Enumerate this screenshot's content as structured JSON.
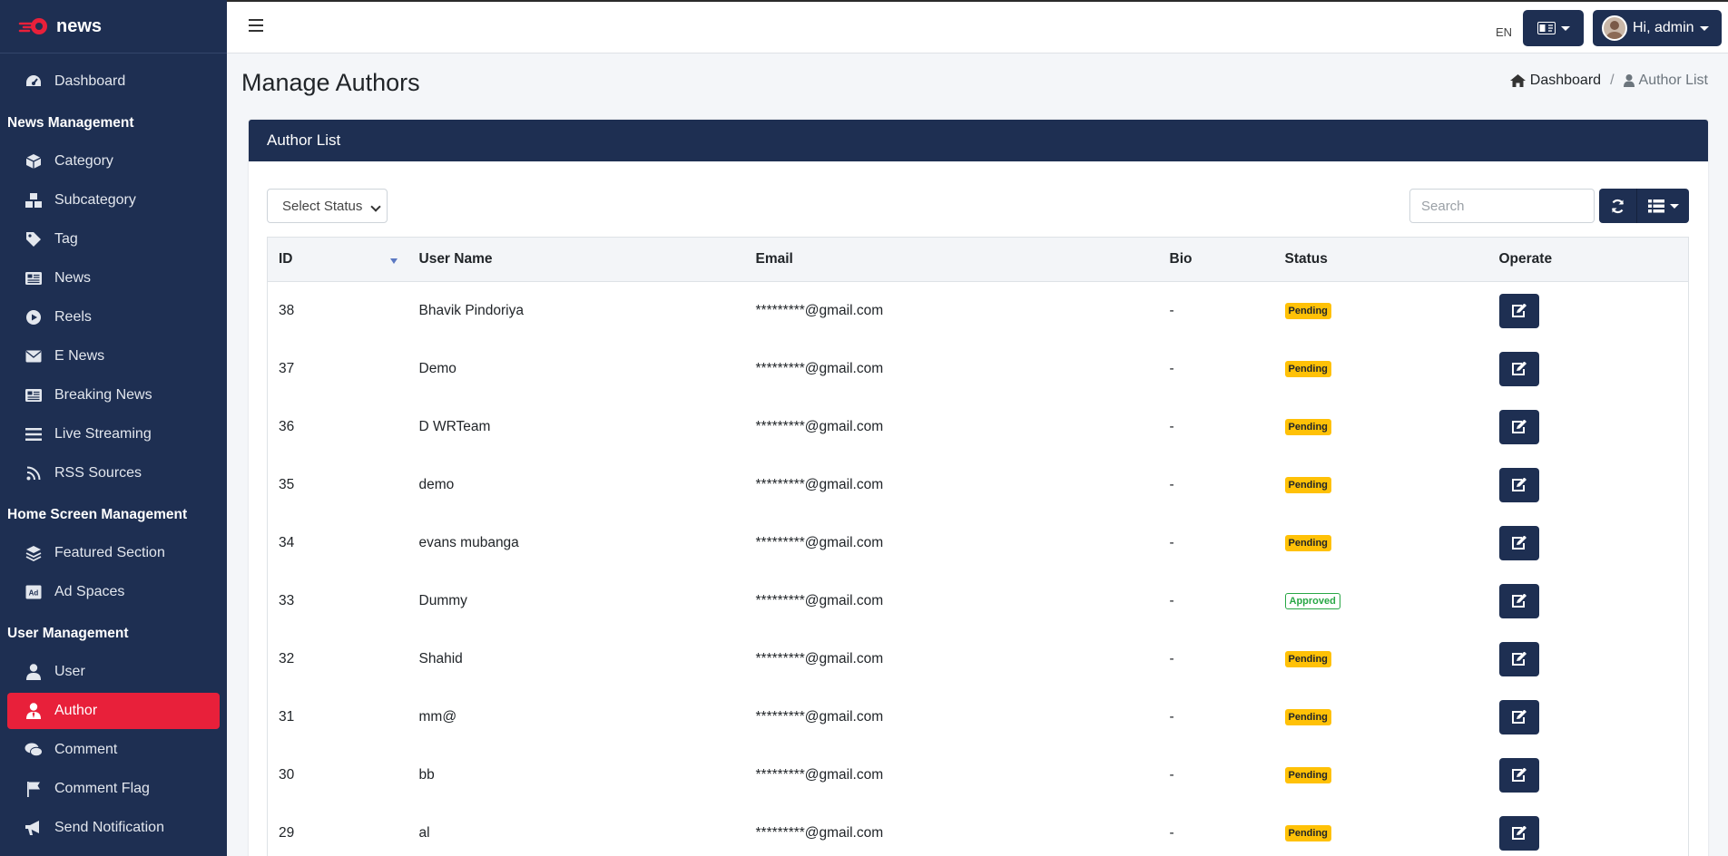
{
  "brand": {
    "name": "news"
  },
  "sidebar": {
    "items": [
      {
        "type": "item",
        "label": "Dashboard",
        "icon": "tachometer-icon",
        "name": "sidebar-item-dashboard"
      },
      {
        "type": "header",
        "label": "News Management"
      },
      {
        "type": "item",
        "label": "Category",
        "icon": "cube-icon",
        "name": "sidebar-item-category"
      },
      {
        "type": "item",
        "label": "Subcategory",
        "icon": "cubes-icon",
        "name": "sidebar-item-subcategory"
      },
      {
        "type": "item",
        "label": "Tag",
        "icon": "tag-icon",
        "name": "sidebar-item-tag"
      },
      {
        "type": "item",
        "label": "News",
        "icon": "newspaper-icon",
        "name": "sidebar-item-news"
      },
      {
        "type": "item",
        "label": "Reels",
        "icon": "play-circle-icon",
        "name": "sidebar-item-reels"
      },
      {
        "type": "item",
        "label": "E News",
        "icon": "envelope-icon",
        "name": "sidebar-item-e-news"
      },
      {
        "type": "item",
        "label": "Breaking News",
        "icon": "newspaper-icon",
        "name": "sidebar-item-breaking-news"
      },
      {
        "type": "item",
        "label": "Live Streaming",
        "icon": "bars-icon",
        "name": "sidebar-item-live-streaming"
      },
      {
        "type": "item",
        "label": "RSS Sources",
        "icon": "rss-icon",
        "name": "sidebar-item-rss-sources"
      },
      {
        "type": "header",
        "label": "Home Screen Management"
      },
      {
        "type": "item",
        "label": "Featured Section",
        "icon": "layers-icon",
        "name": "sidebar-item-featured-section"
      },
      {
        "type": "item",
        "label": "Ad Spaces",
        "icon": "ad-icon",
        "name": "sidebar-item-ad-spaces"
      },
      {
        "type": "header",
        "label": "User Management"
      },
      {
        "type": "item",
        "label": "User",
        "icon": "user-icon",
        "name": "sidebar-item-user"
      },
      {
        "type": "item",
        "label": "Author",
        "icon": "user-tie-icon",
        "name": "sidebar-item-author",
        "active": true
      },
      {
        "type": "item",
        "label": "Comment",
        "icon": "comments-icon",
        "name": "sidebar-item-comment"
      },
      {
        "type": "item",
        "label": "Comment Flag",
        "icon": "flag-icon",
        "name": "sidebar-item-comment-flag"
      },
      {
        "type": "item",
        "label": "Send Notification",
        "icon": "bullhorn-icon",
        "name": "sidebar-item-send-notification"
      }
    ]
  },
  "topbar": {
    "language_code": "EN",
    "user_greeting": "Hi, admin"
  },
  "page": {
    "title": "Manage Authors",
    "breadcrumb": {
      "home": "Dashboard",
      "current": "Author List"
    }
  },
  "card": {
    "title": "Author List",
    "status_select": "Select Status",
    "search_placeholder": "Search"
  },
  "table": {
    "columns": [
      "ID",
      "User Name",
      "Email",
      "Bio",
      "Status",
      "Operate"
    ],
    "rows": [
      {
        "id": "38",
        "name": "Bhavik Pindoriya",
        "email": "*********@gmail.com",
        "bio": "-",
        "status": "Pending"
      },
      {
        "id": "37",
        "name": "Demo",
        "email": "*********@gmail.com",
        "bio": "-",
        "status": "Pending"
      },
      {
        "id": "36",
        "name": "D WRTeam",
        "email": "*********@gmail.com",
        "bio": "-",
        "status": "Pending"
      },
      {
        "id": "35",
        "name": "demo",
        "email": "*********@gmail.com",
        "bio": "-",
        "status": "Pending"
      },
      {
        "id": "34",
        "name": "evans mubanga",
        "email": "*********@gmail.com",
        "bio": "-",
        "status": "Pending"
      },
      {
        "id": "33",
        "name": "Dummy",
        "email": "*********@gmail.com",
        "bio": "-",
        "status": "Approved"
      },
      {
        "id": "32",
        "name": "Shahid",
        "email": "*********@gmail.com",
        "bio": "-",
        "status": "Pending"
      },
      {
        "id": "31",
        "name": "mm@",
        "email": "*********@gmail.com",
        "bio": "-",
        "status": "Pending"
      },
      {
        "id": "30",
        "name": "bb",
        "email": "*********@gmail.com",
        "bio": "-",
        "status": "Pending"
      },
      {
        "id": "29",
        "name": "al",
        "email": "*********@gmail.com",
        "bio": "-",
        "status": "Pending"
      }
    ]
  },
  "colors": {
    "navy": "#1e2f52",
    "accent_red": "#e8203a",
    "pending": "#ffc107",
    "approved": "#28a745"
  }
}
